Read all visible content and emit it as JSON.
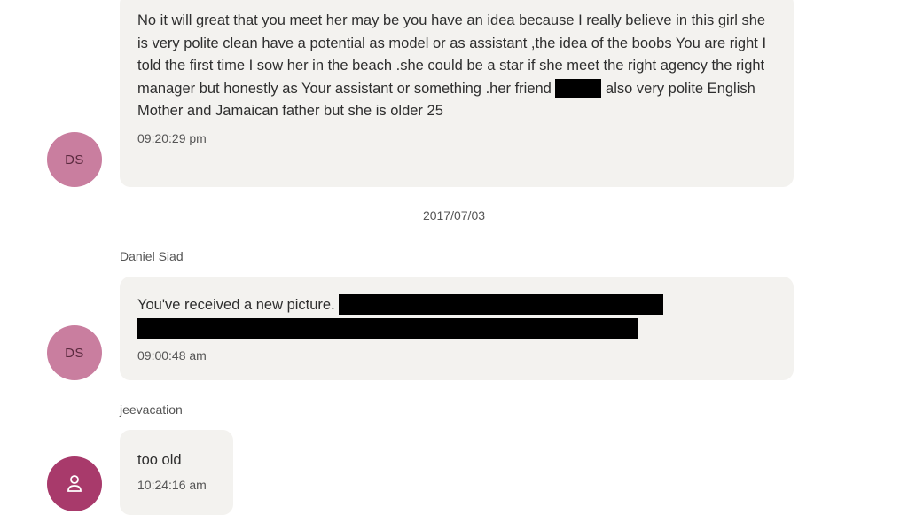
{
  "messages": [
    {
      "text_before": "No it will great that you meet her may be  you have an idea because I really believe in this girl she is very polite clean have a potential as model or as assistant ,the idea of the boobs You are right I told the first time I sow her in the beach .she could be a star if she meet the right agency the right manager but honestly as Your assistant or something .her friend",
      "text_after": "also very polite English Mother and Jamaican father but she is older 25",
      "time": "09:20:29 pm",
      "avatar": "DS"
    },
    {
      "sender": "Daniel Siad",
      "text": "You've received a new picture.",
      "time": "09:00:48 am",
      "avatar": "DS"
    },
    {
      "sender": "jeevacation",
      "text": "too old",
      "time": "10:24:16 am",
      "avatar_icon": "user-icon"
    }
  ],
  "date_separator": "2017/07/03",
  "colors": {
    "bubble": "#f3f2ef",
    "avatar_ds": "#c97e9f",
    "avatar_user": "#a83a6b",
    "redaction": "#000000"
  }
}
